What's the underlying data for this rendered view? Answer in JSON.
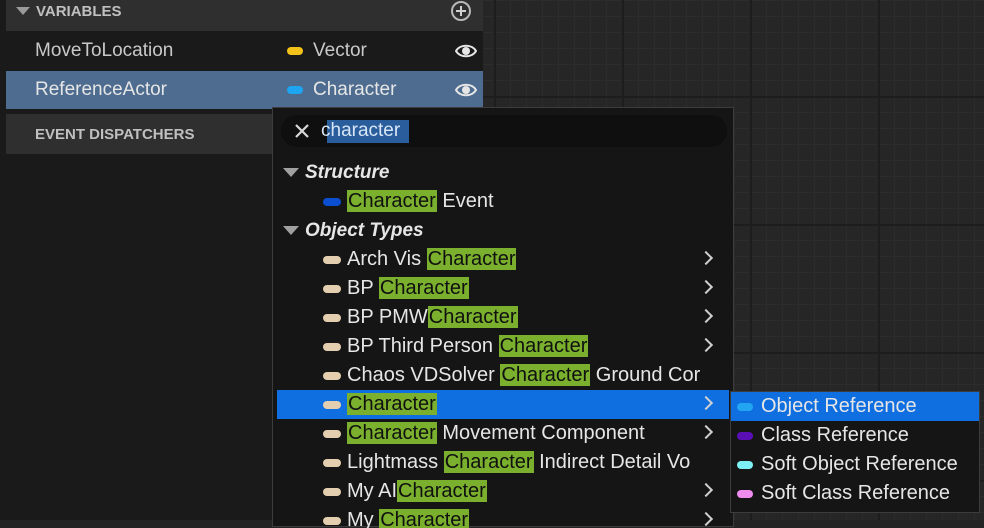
{
  "variables_panel": {
    "header": "VARIABLES",
    "rows": [
      {
        "name": "MoveToLocation",
        "type": "Vector",
        "type_color": "#f2c21b"
      },
      {
        "name": "ReferenceActor",
        "type": "Character",
        "type_color": "#1ea5f2"
      }
    ],
    "event_dispatchers_header": "EVENT DISPATCHERS"
  },
  "type_picker": {
    "search_value": "character",
    "categories": [
      {
        "label": "Structure",
        "items": [
          {
            "parts": [
              {
                "t": "Character",
                "hl": true
              },
              {
                "t": " Event",
                "hl": false
              }
            ],
            "pill": "#0a4fd0",
            "submenu": false
          }
        ]
      },
      {
        "label": "Object Types",
        "items": [
          {
            "parts": [
              {
                "t": "Arch Vis ",
                "hl": false
              },
              {
                "t": "Character",
                "hl": true
              }
            ],
            "pill": "#e3cfb0",
            "submenu": true
          },
          {
            "parts": [
              {
                "t": "BP ",
                "hl": false
              },
              {
                "t": "Character",
                "hl": true
              }
            ],
            "pill": "#e3cfb0",
            "submenu": true
          },
          {
            "parts": [
              {
                "t": "BP PMW",
                "hl": false
              },
              {
                "t": "Character",
                "hl": true
              }
            ],
            "pill": "#e3cfb0",
            "submenu": true
          },
          {
            "parts": [
              {
                "t": "BP Third Person ",
                "hl": false
              },
              {
                "t": "Character",
                "hl": true
              }
            ],
            "pill": "#e3cfb0",
            "submenu": true
          },
          {
            "parts": [
              {
                "t": "Chaos VDSolver ",
                "hl": false
              },
              {
                "t": "Character",
                "hl": true
              },
              {
                "t": " Ground Cor",
                "hl": false
              }
            ],
            "pill": "#e3cfb0",
            "submenu": false
          },
          {
            "parts": [
              {
                "t": "Character",
                "hl": true
              }
            ],
            "pill": "#e3cfb0",
            "submenu": true,
            "selected": true
          },
          {
            "parts": [
              {
                "t": "Character",
                "hl": true
              },
              {
                "t": " Movement Component",
                "hl": false
              }
            ],
            "pill": "#e3cfb0",
            "submenu": true
          },
          {
            "parts": [
              {
                "t": "Lightmass ",
                "hl": false
              },
              {
                "t": "Character",
                "hl": true
              },
              {
                "t": " Indirect Detail Vo",
                "hl": false
              }
            ],
            "pill": "#e3cfb0",
            "submenu": false
          },
          {
            "parts": [
              {
                "t": "My AI",
                "hl": false
              },
              {
                "t": "Character",
                "hl": true
              }
            ],
            "pill": "#e3cfb0",
            "submenu": true
          },
          {
            "parts": [
              {
                "t": "My ",
                "hl": false
              },
              {
                "t": "Character",
                "hl": true
              }
            ],
            "pill": "#e3cfb0",
            "submenu": true
          }
        ]
      }
    ],
    "submenu": [
      {
        "label": "Object Reference",
        "pill": "#22a6f2",
        "selected": true
      },
      {
        "label": "Class Reference",
        "pill": "#5a0fb4",
        "selected": false
      },
      {
        "label": "Soft Object Reference",
        "pill": "#7df0f5",
        "selected": false
      },
      {
        "label": "Soft Class Reference",
        "pill": "#f08cf0",
        "selected": false
      }
    ]
  }
}
